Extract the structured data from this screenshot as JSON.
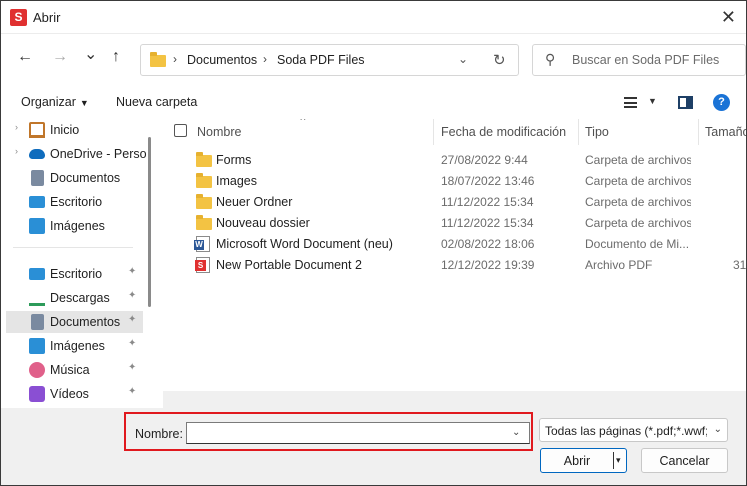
{
  "window": {
    "title": "Abrir",
    "app_icon_letter": "S",
    "close_glyph": "✕"
  },
  "nav": {
    "back_glyph": "←",
    "forward_glyph": "→",
    "recent_glyph": "⌄",
    "up_glyph": "↑",
    "breadcrumb": [
      "Documentos",
      "Soda PDF Files"
    ],
    "breadcrumb_sep": "›",
    "dropdown_glyph": "⌄",
    "refresh_glyph": "↻",
    "search_placeholder": "Buscar en Soda PDF Files",
    "search_glyph": "⚲"
  },
  "toolbar": {
    "organize_label": "Organizar",
    "new_folder_label": "Nueva carpeta",
    "help_glyph": "?"
  },
  "sidebar": {
    "groups": [
      [
        {
          "label": "Inicio",
          "icon": "home-icon",
          "chevron": "›",
          "pinned": false,
          "selected": false
        },
        {
          "label": "OneDrive - Perso",
          "icon": "onedrive-cloud-icon",
          "chevron": "›",
          "pinned": false,
          "selected": false
        },
        {
          "label": "Documentos",
          "icon": "documents-icon",
          "chevron": "",
          "pinned": false,
          "selected": false
        },
        {
          "label": "Escritorio",
          "icon": "desktop-icon",
          "chevron": "",
          "pinned": false,
          "selected": false
        },
        {
          "label": "Imágenes",
          "icon": "pictures-icon",
          "chevron": "",
          "pinned": false,
          "selected": false
        }
      ],
      [
        {
          "label": "Escritorio",
          "icon": "desktop-icon",
          "chevron": "",
          "pinned": true,
          "selected": false
        },
        {
          "label": "Descargas",
          "icon": "downloads-icon",
          "chevron": "",
          "pinned": true,
          "selected": false
        },
        {
          "label": "Documentos",
          "icon": "documents-icon",
          "chevron": "",
          "pinned": true,
          "selected": true
        },
        {
          "label": "Imágenes",
          "icon": "pictures-icon",
          "chevron": "",
          "pinned": true,
          "selected": false
        },
        {
          "label": "Música",
          "icon": "music-icon",
          "chevron": "",
          "pinned": true,
          "selected": false
        },
        {
          "label": "Vídeos",
          "icon": "videos-icon",
          "chevron": "",
          "pinned": true,
          "selected": false
        }
      ]
    ],
    "pin_glyph": "📌"
  },
  "filelist": {
    "columns": {
      "name": "Nombre",
      "modified": "Fecha de modificación",
      "type": "Tipo",
      "size": "Tamaño"
    },
    "sort_glyph": "˄",
    "rows": [
      {
        "name": "Forms",
        "modified": "27/08/2022 9:44",
        "type": "Carpeta de archivos",
        "size": "",
        "icon": "folder-icon"
      },
      {
        "name": "Images",
        "modified": "18/07/2022 13:46",
        "type": "Carpeta de archivos",
        "size": "",
        "icon": "folder-icon"
      },
      {
        "name": "Neuer Ordner",
        "modified": "11/12/2022 15:34",
        "type": "Carpeta de archivos",
        "size": "",
        "icon": "folder-icon"
      },
      {
        "name": "Nouveau dossier",
        "modified": "11/12/2022 15:34",
        "type": "Carpeta de archivos",
        "size": "",
        "icon": "folder-icon"
      },
      {
        "name": "Microsoft Word Document (neu)",
        "modified": "02/08/2022 18:06",
        "type": "Documento de Mi...",
        "size": "",
        "icon": "word-doc-icon"
      },
      {
        "name": "New Portable Document 2",
        "modified": "12/12/2022 19:39",
        "type": "Archivo PDF",
        "size": "31",
        "icon": "soda-pdf-icon"
      }
    ]
  },
  "bottom": {
    "name_label": "Nombre:",
    "name_value": "",
    "name_drop_glyph": "⌄",
    "filetype_value": "Todas las páginas (*.pdf;*.wwf;*",
    "filetype_caret": "⌄",
    "open_label": "Abrir",
    "open_caret": "▾",
    "cancel_label": "Cancelar"
  },
  "colors": {
    "accent": "#0067c0",
    "highlight_border": "#e0191e",
    "selected_row": "#e5e5e5"
  }
}
